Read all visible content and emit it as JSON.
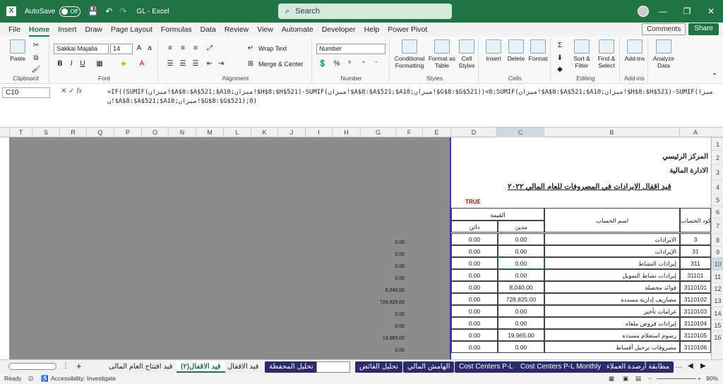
{
  "title": {
    "autosave": "AutoSave",
    "toggle": "Off",
    "doc": "GL  -  Excel",
    "search": "Search"
  },
  "menu": [
    "File",
    "Home",
    "Insert",
    "Draw",
    "Page Layout",
    "Formulas",
    "Data",
    "Review",
    "View",
    "Automate",
    "Developer",
    "Help",
    "Power Pivot"
  ],
  "comments": "Comments",
  "share": "Share",
  "ribbon": {
    "paste": "Paste",
    "clipboard": "Clipboard",
    "font_name": "Sakkal Majalla",
    "font_size": "14",
    "font": "Font",
    "wrap": "Wrap Text",
    "merge": "Merge & Center",
    "alignment": "Alignment",
    "numfmt": "Number",
    "number": "Number",
    "cond": "Conditional Formatting",
    "fmt_table": "Format as Table",
    "cell_styles": "Cell Styles",
    "styles": "Styles",
    "insert": "Insert",
    "delete": "Delete",
    "format": "Format",
    "cells": "Cells",
    "sort": "Sort & Filter",
    "find": "Find & Select",
    "editing": "Editing",
    "addins": "Add-ins",
    "addins_grp": "Add-ins",
    "analyze": "Analyze Data"
  },
  "namebox": "C10",
  "formula": "=IF((SUMIF(ميزان!$A$8:$A$521;$A10;ميزان!$H$8:$H$521)-SUMIF(ميزان!$A$8:$A$521;$A10;ميزان!$G$8:$G$521))<0;SUMIF(ميزان!$A$8:$A$521;$A10;ميزان!$H$8:$H$521)-SUMIF(ميزان!$A$8:$A$521;$A10;ميزان!$G$8:$G$521);0)",
  "columns": [
    "T",
    "S",
    "R",
    "Q",
    "P",
    "O",
    "N",
    "M",
    "L",
    "K",
    "J",
    "I",
    "H",
    "G",
    "F",
    "E",
    "D",
    "C",
    "B",
    "A"
  ],
  "rows": [
    "1",
    "2",
    "3",
    "4",
    "5",
    "6",
    "7",
    "8",
    "9",
    "10",
    "11",
    "12",
    "13",
    "14",
    "15",
    "16"
  ],
  "sheet": {
    "header1": "المركز الرئيسي",
    "header2": "الادارة المالية",
    "title": "قيد اقفال الايرادات في المصروفات للعام المالي ٢٠٢٢",
    "flag": "TRUE",
    "value_hdr": "القيمة",
    "debit": "مدين",
    "credit": "دائن",
    "acct_name": "اسم الحساب",
    "acct_code": "كود الحساب",
    "data": [
      {
        "code": "3",
        "name": "الايرادات",
        "c": "0.00",
        "d": "0.00"
      },
      {
        "code": "31",
        "name": "الإيرادات",
        "c": "0.00",
        "d": "0.00"
      },
      {
        "code": "311",
        "name": "إيرادات النشاط",
        "c": "0.00",
        "d": "0.00"
      },
      {
        "code": "31101",
        "name": "إيرادات نشاط التمويل",
        "c": "0.00",
        "d": "0.00"
      },
      {
        "code": "3110101",
        "name": "فوائد محصلة",
        "c": "8,040.00",
        "d": "0.00"
      },
      {
        "code": "3110102",
        "name": "مصاريف إدارية مسدده",
        "c": "728,825.00",
        "d": "0.00"
      },
      {
        "code": "3110103",
        "name": "غرامات تأخير",
        "c": "0.00",
        "d": "0.00"
      },
      {
        "code": "3110104",
        "name": "إيرادات فروض ملغاه",
        "c": "0.00",
        "d": "0.00"
      },
      {
        "code": "3110105",
        "name": "رسوم استعلام مسدده",
        "c": "19,965.00",
        "d": "0.00"
      },
      {
        "code": "3110106",
        "name": "مصروفات ترحيل أقساط",
        "c": "0.00",
        "d": "0.00"
      }
    ],
    "gvals": [
      "0.00",
      "0.00",
      "0.00",
      "0.00",
      "8,040.00",
      "728,825.00",
      "0.00",
      "0.00",
      "19,965.00",
      "0.00"
    ]
  },
  "tabs": [
    "قيد افتتاح العام المالى",
    "قيد الاقفال(٢)",
    "قيد الاقفال",
    "تحليل المحفظة",
    "",
    "تحليل الفائض",
    "الهامش المالي",
    "Cost Centers P-L",
    "Cost Centers P-L Monthly",
    "مطابقة أرصدة العملاء"
  ],
  "status": {
    "ready": "Ready",
    "access": "Accessibility: Investigate",
    "zoom": "90%"
  }
}
